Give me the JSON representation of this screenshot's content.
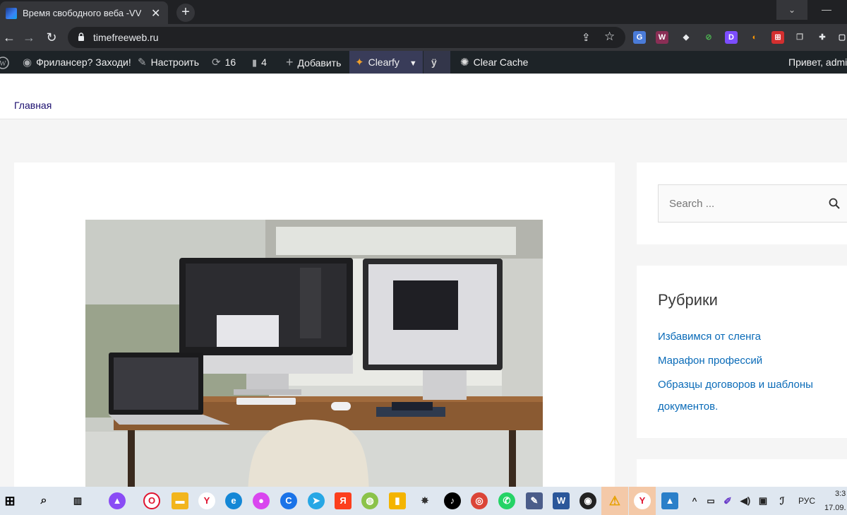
{
  "browser": {
    "tab_title": "Время свободного веба -VV -Ті",
    "tab_close": "✕",
    "new_tab": "+",
    "url": "timefreeweb.ru",
    "window_dropdown": "⌄",
    "window_minimize": "—"
  },
  "extensions": [
    "G",
    "W",
    "D"
  ],
  "wp_admin_bar": {
    "site_label": "Фрилансер? Заходи!",
    "customize_label": "Настроить",
    "updates_count": "16",
    "comments_count": "4",
    "add_label": "Добавить",
    "clearfy_label": "Clearfy",
    "clear_cache_label": "Clear Cache",
    "greeting": "Привет, admin"
  },
  "site": {
    "nav_home": "Главная"
  },
  "sidebar": {
    "search_placeholder": "Search ...",
    "categories_title": "Рубрики",
    "categories": [
      "Избавимся от сленга",
      "Марафон профессий",
      "Образцы договоров и шаблоны",
      "документов."
    ]
  },
  "taskbar": {
    "yandex_letter": "Я",
    "language": "РУС",
    "time": "3:3",
    "date": "17.09."
  },
  "colors": {
    "chrome_dark": "#202124",
    "wp_bar": "#1d2327",
    "link_blue": "#0a6bb8",
    "taskbar": "#dfe7f0"
  }
}
